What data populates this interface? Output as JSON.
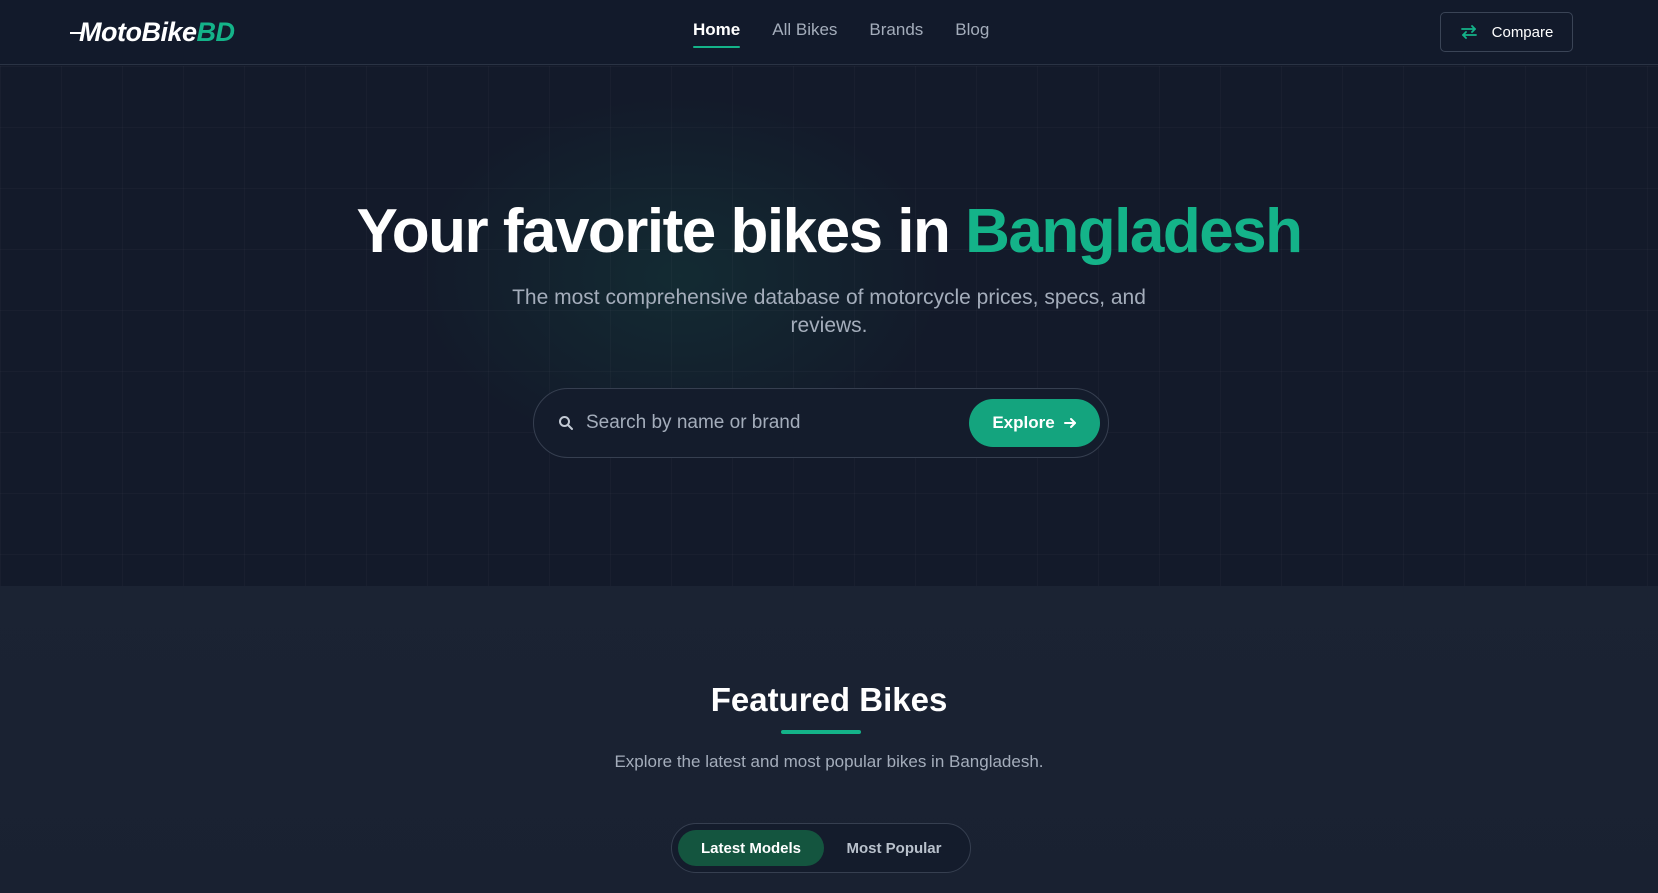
{
  "header": {
    "logo": {
      "main": "MotoBike",
      "accent": "BD"
    },
    "nav": [
      {
        "label": "Home",
        "active": true
      },
      {
        "label": "All Bikes",
        "active": false
      },
      {
        "label": "Brands",
        "active": false
      },
      {
        "label": "Blog",
        "active": false
      }
    ],
    "compare_label": "Compare",
    "compare_icon": "arrows-swap-icon"
  },
  "hero": {
    "title_main": "Your favorite bikes in",
    "title_accent": "Bangladesh",
    "subtitle": "The most comprehensive database of motorcycle prices, specs, and reviews.",
    "search": {
      "placeholder": "Search by name or brand",
      "value": "",
      "icon": "search-icon"
    },
    "explore_label": "Explore",
    "explore_icon": "arrow-right-icon"
  },
  "featured": {
    "title": "Featured Bikes",
    "subtitle": "Explore the latest and most popular bikes in Bangladesh.",
    "tabs": [
      {
        "label": "Latest Models",
        "active": true
      },
      {
        "label": "Most Popular",
        "active": false
      }
    ]
  },
  "colors": {
    "accent": "#14b389",
    "button_bg": "#14a47e",
    "active_tab_bg": "#14553f",
    "page_bg": "#131a2a",
    "muted_text": "#a4adbb"
  }
}
